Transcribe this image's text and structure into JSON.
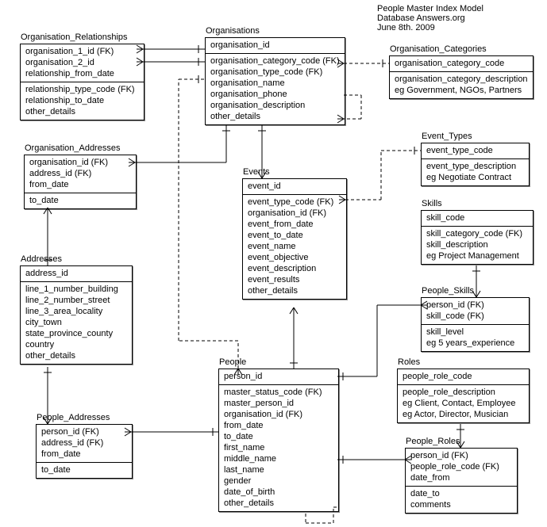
{
  "header": {
    "line1": "People Master Index  Model",
    "line2": "Database Answers.org",
    "line3": "June 8th. 2009"
  },
  "entities": {
    "org_rel": {
      "title": "Organisation_Relationships",
      "pk": [
        "organisation_1_id (FK)",
        "organisation_2_id",
        "relationship_from_date"
      ],
      "attrs": [
        "relationship_type_code (FK)",
        "relationship_to_date",
        "other_details"
      ]
    },
    "orgs": {
      "title": "Organisations",
      "pk": [
        "organisation_id"
      ],
      "attrs": [
        "organisation_category_code (FK)",
        "organisation_type_code (FK)",
        "organisation_name",
        "organisation_phone",
        "organisation_description",
        "other_details"
      ]
    },
    "org_cat": {
      "title": "Organisation_Categories",
      "pk": [
        "organisation_category_code"
      ],
      "attrs": [
        "organisation_category_description",
        "eg Government, NGOs, Partners"
      ]
    },
    "org_addr": {
      "title": "Organisation_Addresses",
      "pk": [
        "organisation_id (FK)",
        "address_id (FK)",
        "from_date"
      ],
      "attrs": [
        "to_date"
      ]
    },
    "events": {
      "title": "Events",
      "pk": [
        "event_id"
      ],
      "attrs": [
        "event_type_code (FK)",
        "organisation_id (FK)",
        "event_from_date",
        "event_to_date",
        "event_name",
        "event_objective",
        "event_description",
        "event_results",
        "other_details"
      ]
    },
    "event_types": {
      "title": "Event_Types",
      "pk": [
        "event_type_code"
      ],
      "attrs": [
        "event_type_description",
        "eg Negotiate Contract"
      ]
    },
    "skills": {
      "title": "Skills",
      "pk": [
        "skill_code"
      ],
      "attrs": [
        "skill_category_code (FK)",
        "skill_description",
        "eg Project Management"
      ]
    },
    "addresses": {
      "title": "Addresses",
      "pk": [
        "address_id"
      ],
      "attrs": [
        "line_1_number_building",
        "line_2_number_street",
        "line_3_area_locality",
        "city_town",
        "state_province_county",
        "country",
        "other_details"
      ]
    },
    "people_skills": {
      "title": "People_Skills",
      "pk": [
        "person_id (FK)",
        "skill_code (FK)"
      ],
      "attrs": [
        "skill_level",
        "eg 5 years_experience"
      ]
    },
    "people": {
      "title": "People",
      "pk": [
        "person_id"
      ],
      "attrs": [
        "master_status_code (FK)",
        "master_person_id",
        "organisation_id (FK)",
        "from_date",
        "to_date",
        "first_name",
        "middle_name",
        "last_name",
        "gender",
        "date_of_birth",
        "other_details"
      ]
    },
    "roles": {
      "title": "Roles",
      "pk": [
        "people_role_code"
      ],
      "attrs": [
        "people_role_description",
        "eg Client, Contact, Employee",
        "eg Actor, Director, Musician"
      ]
    },
    "people_addr": {
      "title": "People_Addresses",
      "pk": [
        "person_id (FK)",
        "address_id (FK)",
        "from_date"
      ],
      "attrs": [
        "to_date"
      ]
    },
    "people_roles": {
      "title": "People_Roles",
      "pk": [
        "person_id (FK)",
        "people_role_code (FK)",
        "date_from"
      ],
      "attrs": [
        "date_to",
        "comments"
      ]
    }
  }
}
